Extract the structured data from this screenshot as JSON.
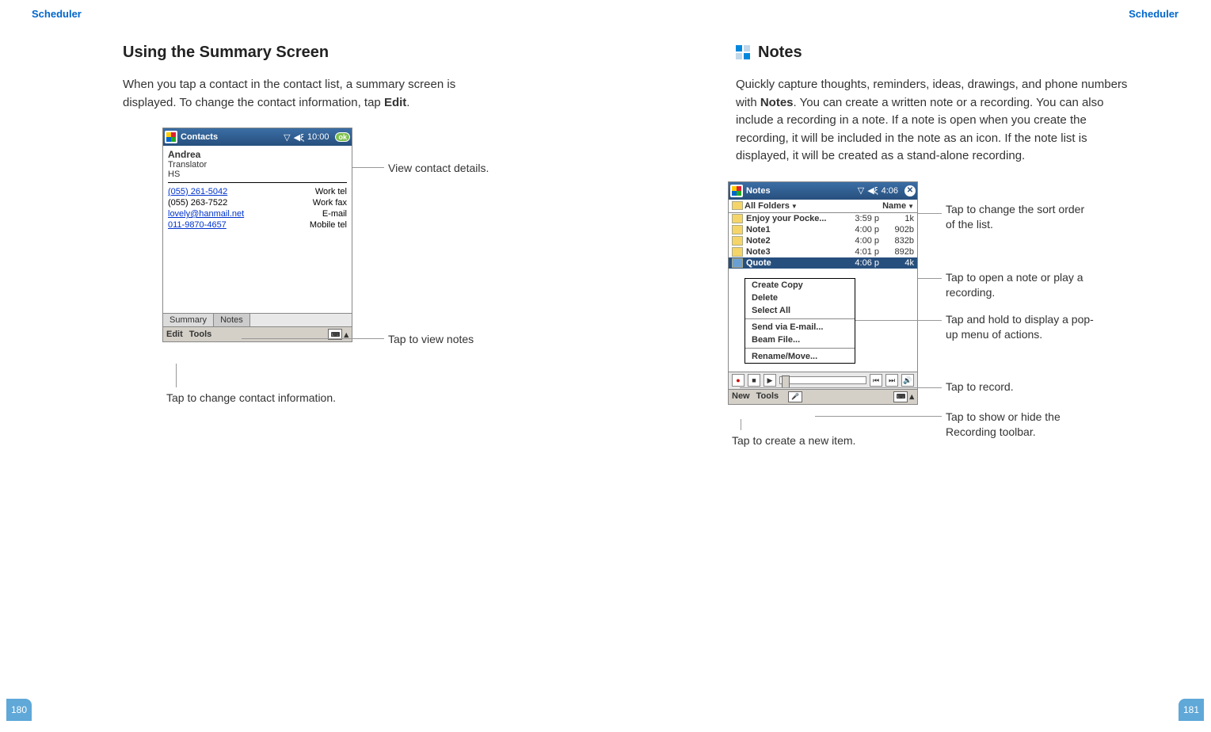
{
  "left": {
    "header": "Scheduler",
    "page_number": "180",
    "heading": "Using the Summary Screen",
    "body": "When you tap a contact in the contact list, a summary screen is displayed. To change the contact information, tap ",
    "body_bold": "Edit",
    "body_after": ".",
    "callouts": {
      "view_details": "View contact details.",
      "tap_notes": "Tap to view notes",
      "tap_edit": "Tap to change contact information."
    },
    "device": {
      "title": "Contacts",
      "time": "10:00",
      "ok": "ok",
      "contact": {
        "name": "Andrea",
        "role": "Translator",
        "org": "HS",
        "rows": [
          {
            "value": "(055) 261-5042",
            "label": "Work tel",
            "underline": true
          },
          {
            "value": "(055) 263-7522",
            "label": "Work fax",
            "underline": false
          },
          {
            "value": "lovely@hanmail.net",
            "label": "E-mail",
            "underline": true
          },
          {
            "value": "011-9870-4657",
            "label": "Mobile tel",
            "underline": true
          }
        ]
      },
      "tabs": {
        "summary": "Summary",
        "notes": "Notes"
      },
      "bottom": {
        "edit": "Edit",
        "tools": "Tools"
      }
    }
  },
  "right": {
    "header": "Scheduler",
    "page_number": "181",
    "heading": "Notes",
    "body_pre": "Quickly capture thoughts, reminders, ideas, drawings, and phone numbers with ",
    "body_bold": "Notes",
    "body_post": ". You can create a written note or a recording. You can also include a recording in a note. If a note is open when you create the recording, it will be included in the note as an icon. If the note list is displayed, it will be created as a stand-alone recording.",
    "callouts": {
      "sort": "Tap to change the sort order of the list.",
      "open": "Tap to open a note or play a recording.",
      "popup": "Tap and hold to display a pop-up menu of actions.",
      "record": "Tap to record.",
      "toolbar": "Tap to show or hide the Recording toolbar.",
      "new_item": "Tap to create a new item."
    },
    "device": {
      "title": "Notes",
      "time": "4:06",
      "filter": {
        "folders": "All Folders",
        "sort": "Name"
      },
      "notes": [
        {
          "name": "Enjoy your Pocke...",
          "time": "3:59 p",
          "size": "1k"
        },
        {
          "name": "Note1",
          "time": "4:00 p",
          "size": "902b"
        },
        {
          "name": "Note2",
          "time": "4:00 p",
          "size": "832b"
        },
        {
          "name": "Note3",
          "time": "4:01 p",
          "size": "892b"
        },
        {
          "name": "Quote",
          "time": "4:06 p",
          "size": "4k",
          "selected": true
        }
      ],
      "menu": [
        "Create Copy",
        "Delete",
        "Select All",
        "Send via E-mail...",
        "Beam File...",
        "Rename/Move..."
      ],
      "bottom": {
        "new": "New",
        "tools": "Tools"
      }
    }
  }
}
